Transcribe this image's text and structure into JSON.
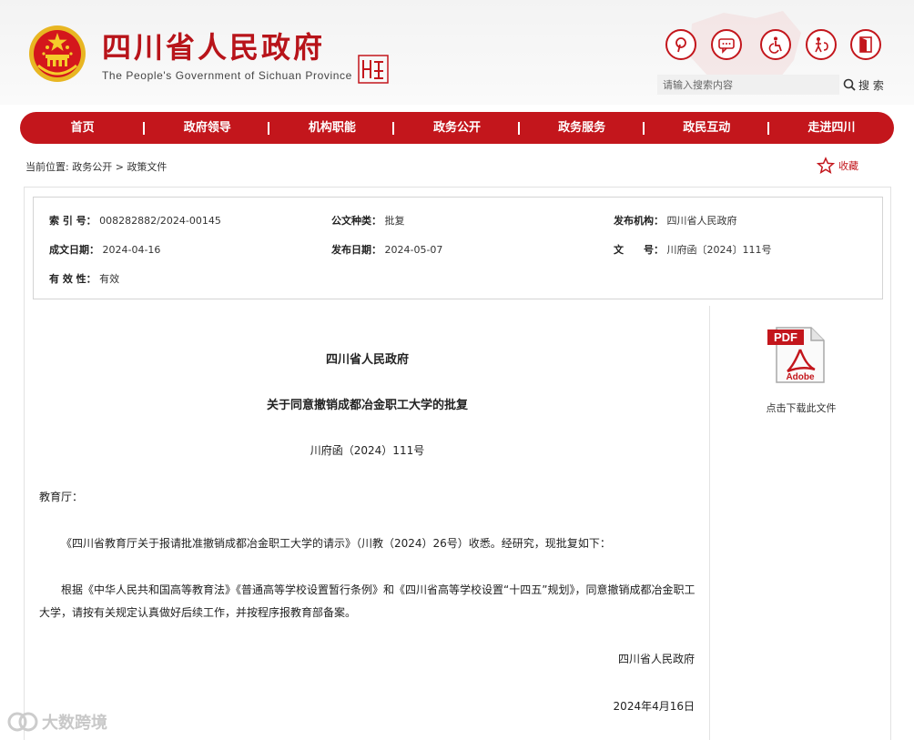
{
  "header": {
    "title": "四川省人民政府",
    "subtitle": "The People's Government of Sichuan Province",
    "search_placeholder": "请输入搜索内容",
    "search_label": "搜 索"
  },
  "nav": {
    "items": [
      {
        "label": "首页"
      },
      {
        "label": "政府领导"
      },
      {
        "label": "机构职能"
      },
      {
        "label": "政务公开"
      },
      {
        "label": "政务服务"
      },
      {
        "label": "政民互动"
      },
      {
        "label": "走进四川"
      }
    ]
  },
  "breadcrumb": {
    "prefix": "当前位置:",
    "items": [
      "政务公开",
      "政策文件"
    ],
    "separator": ">"
  },
  "favorite_label": "收藏",
  "meta": {
    "index_no_label": "索 引 号：",
    "index_no": "008282882/2024-00145",
    "type_label": "公文种类：",
    "type": "批复",
    "issuer_label": "发布机构：",
    "issuer": "四川省人民政府",
    "created_label": "成文日期：",
    "created": "2024-04-16",
    "published_label": "发布日期：",
    "published": "2024-05-07",
    "doc_no_label": "文　　号：",
    "doc_no": "川府函〔2024〕111号",
    "validity_label": "有 效 性：",
    "validity": "有效"
  },
  "document": {
    "issuer": "四川省人民政府",
    "title": "关于同意撤销成都冶金职工大学的批复",
    "number": "川府函（2024）111号",
    "salutation": "教育厅：",
    "para1": "《四川省教育厅关于报请批准撤销成都冶金职工大学的请示》（川教（2024）26号）收悉。经研究，现批复如下：",
    "para2": "根据《中华人民共和国高等教育法》《普通高等学校设置暂行条例》和《四川省高等学校设置“十四五”规划》，同意撤销成都冶金职工大学，请按有关规定认真做好后续工作，并按程序报教育部备案。",
    "signature": "四川省人民政府",
    "date": "2024年4月16日"
  },
  "sidebar": {
    "pdf_label": "PDF",
    "adobe_label": "Adobe",
    "download_label": "点击下载此文件"
  },
  "watermark": "大数跨境",
  "colors": {
    "brand_red": "#c3161c"
  }
}
